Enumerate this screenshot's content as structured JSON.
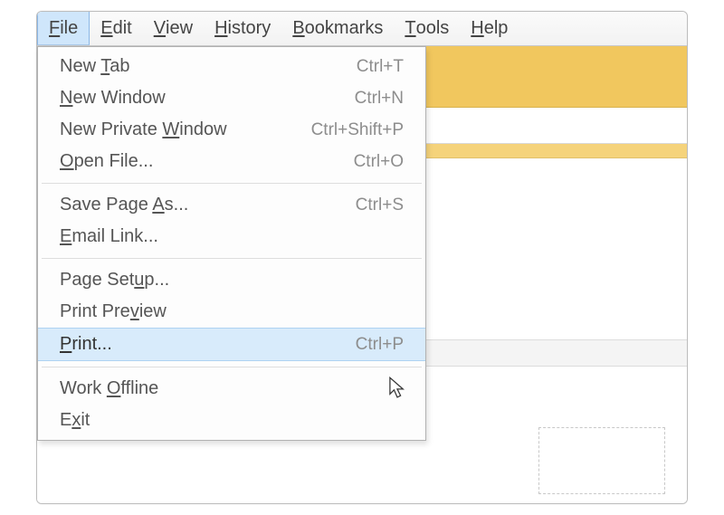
{
  "menu_bar": [
    {
      "pre": "",
      "mn": "F",
      "post": "ile",
      "active": true
    },
    {
      "pre": "",
      "mn": "E",
      "post": "dit",
      "active": false
    },
    {
      "pre": "",
      "mn": "V",
      "post": "iew",
      "active": false
    },
    {
      "pre": "",
      "mn": "H",
      "post": "istory",
      "active": false
    },
    {
      "pre": "",
      "mn": "B",
      "post": "ookmarks",
      "active": false
    },
    {
      "pre": "",
      "mn": "T",
      "post": "ools",
      "active": false
    },
    {
      "pre": "",
      "mn": "H",
      "post": "elp",
      "active": false
    }
  ],
  "dropdown": [
    {
      "kind": "item",
      "pre": "New ",
      "mn": "T",
      "post": "ab",
      "shortcut": "Ctrl+T",
      "hover": false
    },
    {
      "kind": "item",
      "pre": "",
      "mn": "N",
      "post": "ew Window",
      "shortcut": "Ctrl+N",
      "hover": false
    },
    {
      "kind": "item",
      "pre": "New Private ",
      "mn": "W",
      "post": "indow",
      "shortcut": "Ctrl+Shift+P",
      "hover": false
    },
    {
      "kind": "item",
      "pre": "",
      "mn": "O",
      "post": "pen File...",
      "shortcut": "Ctrl+O",
      "hover": false
    },
    {
      "kind": "sep"
    },
    {
      "kind": "item",
      "pre": "Save Page ",
      "mn": "A",
      "post": "s...",
      "shortcut": "Ctrl+S",
      "hover": false
    },
    {
      "kind": "item",
      "pre": "",
      "mn": "E",
      "post": "mail Link...",
      "shortcut": "",
      "hover": false
    },
    {
      "kind": "sep"
    },
    {
      "kind": "item",
      "pre": "Page Set",
      "mn": "u",
      "post": "p...",
      "shortcut": "",
      "hover": false
    },
    {
      "kind": "item",
      "pre": "Print Pre",
      "mn": "v",
      "post": "iew",
      "shortcut": "",
      "hover": false
    },
    {
      "kind": "item",
      "pre": "",
      "mn": "P",
      "post": "rint...",
      "shortcut": "Ctrl+P",
      "hover": true
    },
    {
      "kind": "sep"
    },
    {
      "kind": "item",
      "pre": "Work ",
      "mn": "O",
      "post": "ffline",
      "shortcut": "",
      "hover": false
    },
    {
      "kind": "item",
      "pre": "E",
      "mn": "x",
      "post": "it",
      "shortcut": "",
      "hover": false
    }
  ]
}
